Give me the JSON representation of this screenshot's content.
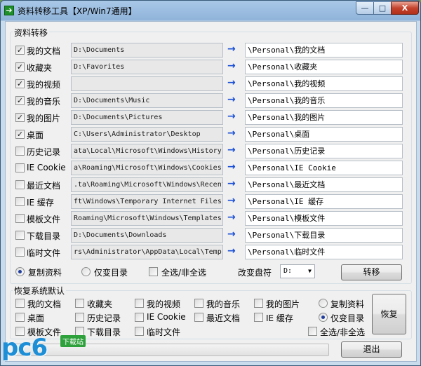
{
  "window": {
    "icon": "arrow-right-icon",
    "title": "资料转移工具【XP/Win7通用】",
    "min_glyph": "—",
    "max_glyph": "□",
    "close_glyph": "X"
  },
  "transfer": {
    "group_title": "资料转移",
    "rows": [
      {
        "label": "我的文档",
        "checked": true,
        "source": "D:\\Documents",
        "source_clipped": false,
        "target": "\\Personal\\我的文档"
      },
      {
        "label": "收藏夹",
        "checked": true,
        "source": "D:\\Favorites",
        "source_clipped": false,
        "target": "\\Personal\\收藏夹"
      },
      {
        "label": "我的视频",
        "checked": true,
        "source": "",
        "source_clipped": false,
        "target": "\\Personal\\我的视频"
      },
      {
        "label": "我的音乐",
        "checked": true,
        "source": "D:\\Documents\\Music",
        "source_clipped": false,
        "target": "\\Personal\\我的音乐"
      },
      {
        "label": "我的图片",
        "checked": true,
        "source": "D:\\Documents\\Pictures",
        "source_clipped": false,
        "target": "\\Personal\\我的图片"
      },
      {
        "label": "桌面",
        "checked": true,
        "source": "C:\\Users\\Administrator\\Desktop",
        "source_clipped": false,
        "target": "\\Personal\\桌面"
      },
      {
        "label": "历史记录",
        "checked": false,
        "source": "ata\\Local\\Microsoft\\Windows\\History",
        "source_clipped": true,
        "target": "\\Personal\\历史记录"
      },
      {
        "label": "IE Cookie",
        "checked": false,
        "source": "a\\Roaming\\Microsoft\\Windows\\Cookies",
        "source_clipped": true,
        "target": "\\Personal\\IE Cookie"
      },
      {
        "label": "最近文档",
        "checked": false,
        "source": ".ta\\Roaming\\Microsoft\\Windows\\Recent",
        "source_clipped": true,
        "target": "\\Personal\\最近文档"
      },
      {
        "label": "IE 缓存",
        "checked": false,
        "source": "ft\\Windows\\Temporary Internet Files",
        "source_clipped": true,
        "target": "\\Personal\\IE 缓存"
      },
      {
        "label": "模板文件",
        "checked": false,
        "source": "Roaming\\Microsoft\\Windows\\Templates",
        "source_clipped": true,
        "target": "\\Personal\\模板文件"
      },
      {
        "label": "下载目录",
        "checked": false,
        "source": "D:\\Documents\\Downloads",
        "source_clipped": false,
        "target": "\\Personal\\下载目录"
      },
      {
        "label": "临时文件",
        "checked": false,
        "source": "rs\\Administrator\\AppData\\Local\\Temp",
        "source_clipped": true,
        "target": "\\Personal\\临时文件"
      }
    ],
    "arrow_glyph": "→",
    "mode_copy": "复制资料",
    "mode_copy_selected": true,
    "mode_dir_only": "仅变目录",
    "mode_dir_only_selected": false,
    "select_all": "全选/非全选",
    "select_all_checked": false,
    "drive_label": "改变盘符",
    "drive_value": "D:",
    "drive_caret": "▼",
    "transfer_button": "转移"
  },
  "restore": {
    "group_title": "恢复系统默认",
    "items": [
      {
        "label": "我的文档",
        "checked": false
      },
      {
        "label": "收藏夹",
        "checked": false
      },
      {
        "label": "我的视频",
        "checked": false
      },
      {
        "label": "我的音乐",
        "checked": false
      },
      {
        "label": "我的图片",
        "checked": false
      },
      {
        "label": "桌面",
        "checked": false
      },
      {
        "label": "历史记录",
        "checked": false
      },
      {
        "label": "IE Cookie",
        "checked": false
      },
      {
        "label": "最近文档",
        "checked": false
      },
      {
        "label": "IE 缓存",
        "checked": false
      },
      {
        "label": "模板文件",
        "checked": false
      },
      {
        "label": "下载目录",
        "checked": false
      },
      {
        "label": "临时文件",
        "checked": false
      }
    ],
    "mode_copy": "复制资料",
    "mode_copy_selected": false,
    "mode_dir_only": "仅变目录",
    "mode_dir_only_selected": true,
    "select_all": "全选/非全选",
    "select_all_checked": false,
    "restore_button": "恢复"
  },
  "footer": {
    "progress_value": 0,
    "exit_button": "退出"
  },
  "watermark": {
    "logo": "pc6",
    "tag": "下载站"
  },
  "colors": {
    "arrow": "#1a4fd6",
    "panel": "#f0f0f0",
    "close_button": "#c4432d",
    "watermark_blue": "#1e8fd6",
    "watermark_green": "#2fa13c"
  }
}
